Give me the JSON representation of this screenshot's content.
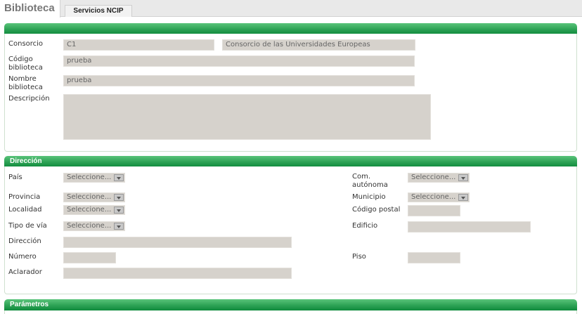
{
  "tabs": {
    "active": "Biblioteca",
    "ncip": "Servicios NCIP"
  },
  "general": {
    "consorcio_label": "Consorcio",
    "consorcio_code": "C1",
    "consorcio_name": "Consorcio de las Universidades Europeas",
    "codigo_label_1": "Código",
    "codigo_label_2": "biblioteca",
    "codigo_value": "prueba",
    "nombre_label_1": "Nombre",
    "nombre_label_2": "biblioteca",
    "nombre_value": "prueba",
    "descripcion_label": "Descripción",
    "descripcion_value": ""
  },
  "direccion": {
    "title": "Dirección",
    "pais_label": "País",
    "pais_value": "Seleccione...",
    "com_label_1": "Com.",
    "com_label_2": "autónoma",
    "com_value": "Seleccione...",
    "provincia_label": "Provincia",
    "provincia_value": "Seleccione...",
    "municipio_label": "Municipio",
    "municipio_value": "Seleccione...",
    "localidad_label": "Localidad",
    "localidad_value": "Seleccione...",
    "codigo_postal_label": "Código postal",
    "codigo_postal_value": "",
    "tipo_via_label": "Tipo de vía",
    "tipo_via_value": "Seleccione...",
    "edificio_label": "Edificio",
    "edificio_value": "",
    "direccion_label": "Dirección",
    "direccion_value": "",
    "numero_label": "Número",
    "numero_value": "",
    "piso_label": "Piso",
    "piso_value": "",
    "aclarador_label": "Aclarador",
    "aclarador_value": ""
  },
  "parametros": {
    "title": "Parámetros"
  },
  "colors": {
    "header_green": "#2da255",
    "field_bg": "#d6d2cc"
  },
  "icons": {
    "select_arrow": "chevron-down-icon"
  }
}
